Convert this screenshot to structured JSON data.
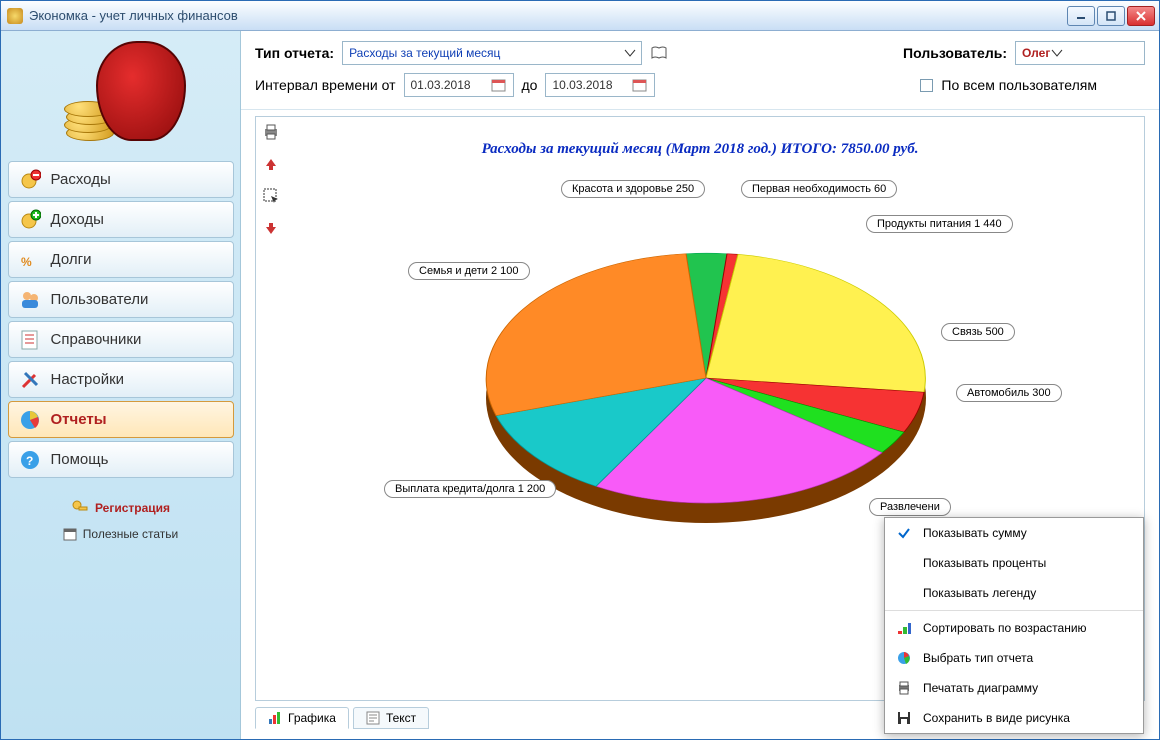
{
  "window": {
    "title": "Экономка - учет личных финансов"
  },
  "sidebar": {
    "items": [
      {
        "label": "Расходы"
      },
      {
        "label": "Доходы"
      },
      {
        "label": "Долги"
      },
      {
        "label": "Пользователи"
      },
      {
        "label": "Справочники"
      },
      {
        "label": "Настройки"
      },
      {
        "label": "Отчеты"
      },
      {
        "label": "Помощь"
      }
    ],
    "register": "Регистрация",
    "articles": "Полезные статьи"
  },
  "toolbar": {
    "report_type_label": "Тип отчета:",
    "report_type_value": "Расходы за текущий месяц",
    "interval_label_from": "Интервал времени от",
    "interval_label_to": "до",
    "date_from": "01.03.2018",
    "date_to": "10.03.2018",
    "user_label": "Пользователь:",
    "user_value": "Олег",
    "all_users": "По всем пользователям"
  },
  "report": {
    "title": "Расходы за текущий месяц (Март 2018 год.) ИТОГО: 7850.00 руб."
  },
  "chart_data": {
    "type": "pie",
    "title": "Расходы за текущий месяц (Март 2018 год.) ИТОГО: 7850.00 руб.",
    "total": 7850,
    "series": [
      {
        "name": "Красота и здоровье",
        "value": 250,
        "color": "#21c44f"
      },
      {
        "name": "Первая необходимость",
        "value": 60,
        "color": "#f63333"
      },
      {
        "name": "Продукты питания",
        "value": 1440,
        "color": "#fff150"
      },
      {
        "name": "Связь",
        "value": 500,
        "color": "#f63333"
      },
      {
        "name": "Автомобиль",
        "value": 300,
        "color": "#1fe01f"
      },
      {
        "name": "Развлечения",
        "value": 2000,
        "color": "#f85bf8"
      },
      {
        "name": "Выплата кредита/долга",
        "value": 1200,
        "color": "#19c9c9"
      },
      {
        "name": "Семья и дети",
        "value": 2100,
        "color": "#ff8a26"
      }
    ]
  },
  "labels": {
    "l0": "Красота и здоровье 250",
    "l1": "Первая необходимость 60",
    "l2": "Продукты питания 1 440",
    "l3": "Связь 500",
    "l4": "Автомобиль 300",
    "l5": "Развлечени",
    "l6": "Выплата кредита/долга 1 200",
    "l7": "Семья и дети 2 100"
  },
  "context_menu": {
    "m0": "Показывать сумму",
    "m1": "Показывать проценты",
    "m2": "Показывать легенду",
    "m3": "Сортировать по возрастанию",
    "m4": "Выбрать тип отчета",
    "m5": "Печатать диаграмму",
    "m6": "Сохранить в виде рисунка"
  },
  "tabs": {
    "t0": "Графика",
    "t1": "Текст"
  }
}
